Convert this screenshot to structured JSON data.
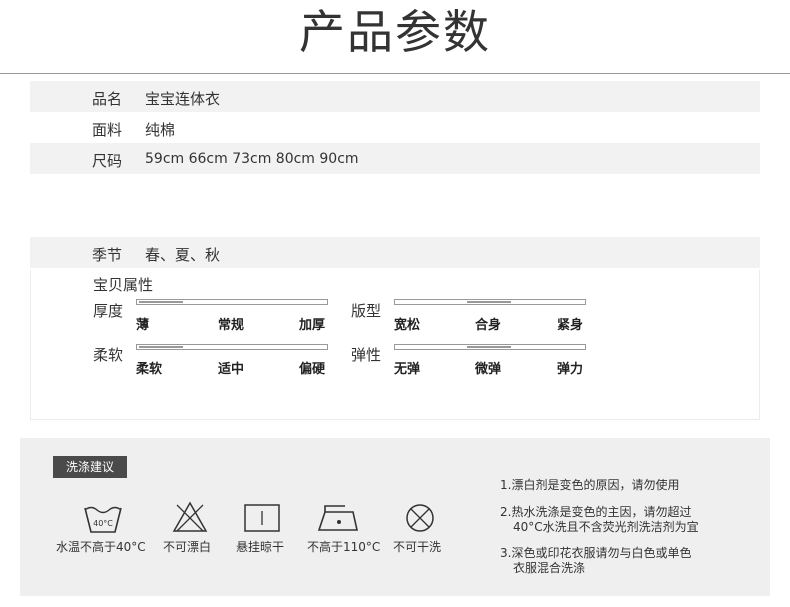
{
  "page_title": "产品参数",
  "params": [
    {
      "label": "品名",
      "value": "宝宝连体衣"
    },
    {
      "label": "面料",
      "value": "纯棉"
    },
    {
      "label": "尺码",
      "value": "59cm 66cm 73cm 80cm 90cm"
    },
    {
      "label": "季节",
      "value": "春、夏、秋"
    }
  ],
  "attributes": {
    "title": "宝贝属性",
    "thickness": {
      "label": "厚度",
      "options": [
        "薄",
        "常规",
        "加厚"
      ],
      "selected_index": 0
    },
    "fit": {
      "label": "版型",
      "options": [
        "宽松",
        "合身",
        "紧身"
      ],
      "selected_index": 1
    },
    "softness": {
      "label": "柔软",
      "options": [
        "柔软",
        "适中",
        "偏硬"
      ],
      "selected_index": 0
    },
    "elasticity": {
      "label": "弹性",
      "options": [
        "无弹",
        "微弹",
        "弹力"
      ],
      "selected_index": 1
    }
  },
  "care": {
    "badge": "洗涤建议",
    "icons": [
      {
        "icon": "wash-40c-icon",
        "caption": "水温不高于40°C",
        "text": "40°C"
      },
      {
        "icon": "no-bleach-icon",
        "caption": "不可漂白"
      },
      {
        "icon": "hang-dry-icon",
        "caption": "悬挂晾干"
      },
      {
        "icon": "iron-110c-icon",
        "caption": "不高于110°C"
      },
      {
        "icon": "no-dry-clean-icon",
        "caption": "不可干洗"
      }
    ],
    "tips": [
      {
        "line1": "1.漂白剂是变色的原因，请勿使用",
        "line2": ""
      },
      {
        "line1": "2.热水洗涤是变色的主因，请勿超过",
        "line2": "40°C水洗且不含荧光剂洗洁剂为宜"
      },
      {
        "line1": "3.深色或印花衣服请勿与白色或单色",
        "line2": "衣服混合洗涤"
      }
    ]
  }
}
